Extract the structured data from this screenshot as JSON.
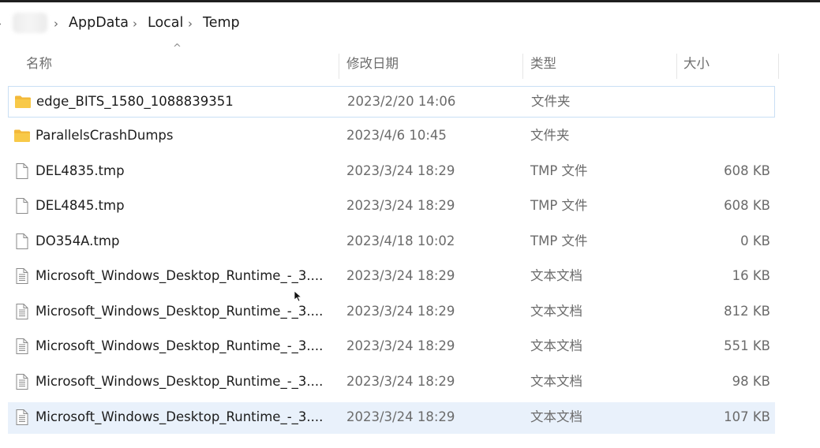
{
  "breadcrumb": {
    "items": [
      {
        "label": "AppData"
      },
      {
        "label": "Local"
      },
      {
        "label": "Temp"
      }
    ]
  },
  "columns": {
    "name": "名称",
    "date": "修改日期",
    "type": "类型",
    "size": "大小"
  },
  "files": [
    {
      "name": "edge_BITS_1580_1088839351",
      "date": "2023/2/20 14:06",
      "type": "文件夹",
      "size": "",
      "icon": "folder-icon"
    },
    {
      "name": "ParallelsCrashDumps",
      "date": "2023/4/6 10:45",
      "type": "文件夹",
      "size": "",
      "icon": "folder-icon"
    },
    {
      "name": "DEL4835.tmp",
      "date": "2023/3/24 18:29",
      "type": "TMP 文件",
      "size": "608 KB",
      "icon": "blank-file-icon"
    },
    {
      "name": "DEL4845.tmp",
      "date": "2023/3/24 18:29",
      "type": "TMP 文件",
      "size": "608 KB",
      "icon": "blank-file-icon"
    },
    {
      "name": "DO354A.tmp",
      "date": "2023/4/18 10:02",
      "type": "TMP 文件",
      "size": "0 KB",
      "icon": "blank-file-icon"
    },
    {
      "name": "Microsoft_Windows_Desktop_Runtime_-_3....",
      "date": "2023/3/24 18:29",
      "type": "文本文档",
      "size": "16 KB",
      "icon": "text-document-icon"
    },
    {
      "name": "Microsoft_Windows_Desktop_Runtime_-_3....",
      "date": "2023/3/24 18:29",
      "type": "文本文档",
      "size": "812 KB",
      "icon": "text-document-icon"
    },
    {
      "name": "Microsoft_Windows_Desktop_Runtime_-_3....",
      "date": "2023/3/24 18:29",
      "type": "文本文档",
      "size": "551 KB",
      "icon": "text-document-icon"
    },
    {
      "name": "Microsoft_Windows_Desktop_Runtime_-_3....",
      "date": "2023/3/24 18:29",
      "type": "文本文档",
      "size": "98 KB",
      "icon": "text-document-icon"
    },
    {
      "name": "Microsoft_Windows_Desktop_Runtime_-_3....",
      "date": "2023/3/24 18:29",
      "type": "文本文档",
      "size": "107 KB",
      "icon": "text-document-icon"
    }
  ],
  "colors": {
    "folder": "#f8c948",
    "focus_border": "#c9dff4",
    "selected_bg": "#e9f1fb"
  }
}
